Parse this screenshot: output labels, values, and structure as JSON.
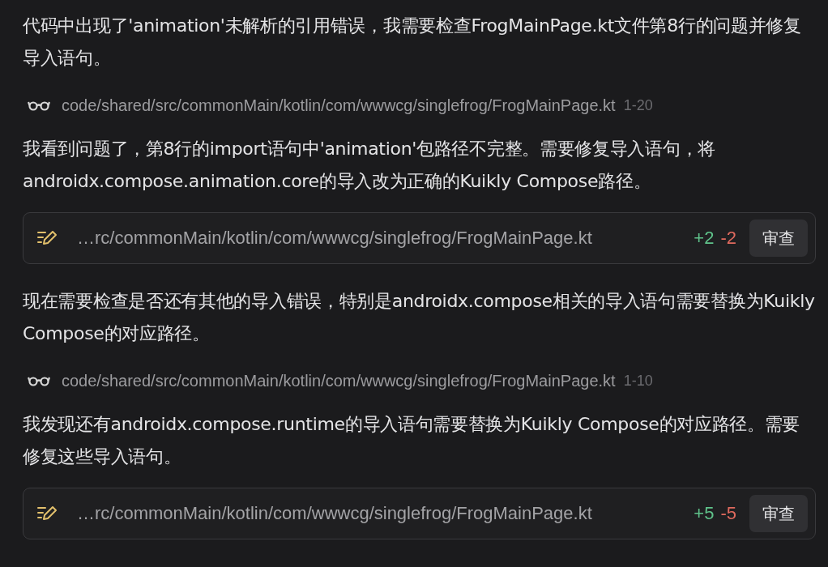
{
  "messages": [
    {
      "kind": "paragraph",
      "text": "代码中出现了'animation'未解析的引用错误，我需要检查FrogMainPage.kt文件第8行的问题并修复导入语句。"
    },
    {
      "kind": "read",
      "path": "code/shared/src/commonMain/kotlin/com/wwwcg/singlefrog/FrogMainPage.kt",
      "range": "1-20"
    },
    {
      "kind": "paragraph",
      "text": "我看到问题了，第8行的import语句中'animation'包路径不完整。需要修复导入语句，将androidx.compose.animation.core的导入改为正确的Kuikly Compose路径。"
    },
    {
      "kind": "edit",
      "path": "…rc/commonMain/kotlin/com/wwwcg/singlefrog/FrogMainPage.kt",
      "added": "+2",
      "removed": "-2",
      "button": "审查"
    },
    {
      "kind": "paragraph",
      "text": "现在需要检查是否还有其他的导入错误，特别是androidx.compose相关的导入语句需要替换为Kuikly Compose的对应路径。"
    },
    {
      "kind": "read",
      "path": "code/shared/src/commonMain/kotlin/com/wwwcg/singlefrog/FrogMainPage.kt",
      "range": "1-10"
    },
    {
      "kind": "paragraph",
      "text": "我发现还有androidx.compose.runtime的导入语句需要替换为Kuikly Compose的对应路径。需要修复这些导入语句。"
    },
    {
      "kind": "edit",
      "path": "…rc/commonMain/kotlin/com/wwwcg/singlefrog/FrogMainPage.kt",
      "added": "+5",
      "removed": "-5",
      "button": "审查"
    }
  ]
}
